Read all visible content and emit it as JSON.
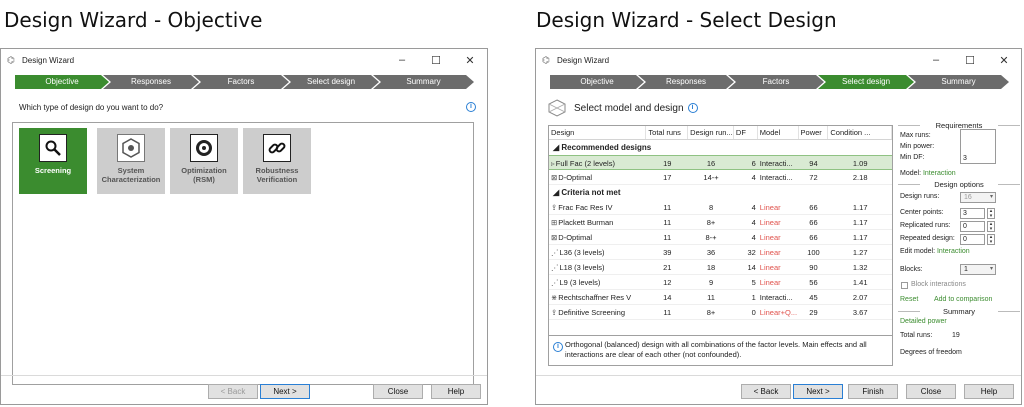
{
  "left": {
    "slide_title": "Design Wizard - Objective",
    "window_title": "Design Wizard",
    "steps": [
      "Objective",
      "Responses",
      "Factors",
      "Select design",
      "Summary"
    ],
    "question": "Which type of design do you want to do?",
    "tiles": [
      {
        "line1": "Screening",
        "line2": ""
      },
      {
        "line1": "System",
        "line2": "Characterization"
      },
      {
        "line1": "Optimization",
        "line2": "(RSM)"
      },
      {
        "line1": "Robustness",
        "line2": "Verification"
      }
    ],
    "buttons": {
      "back": "< Back",
      "next": "Next >",
      "close": "Close",
      "help": "Help"
    }
  },
  "right": {
    "slide_title": "Design Wizard - Select Design",
    "window_title": "Design Wizard",
    "steps": [
      "Objective",
      "Responses",
      "Factors",
      "Select design",
      "Summary"
    ],
    "header": "Select model and design",
    "columns": [
      "Design",
      "Total runs",
      "Design run...",
      "DF",
      "Model",
      "Power",
      "Condition ..."
    ],
    "recommended_label": "Recommended designs",
    "recommended": [
      {
        "icon": "▹",
        "design": "Full Fac (2 levels)",
        "total": "19",
        "runs": "16",
        "df": "6",
        "model": "Interacti...",
        "power": "94",
        "cond": "1.09"
      },
      {
        "icon": "⊠",
        "design": "D-Optimal",
        "total": "17",
        "runs": "14-+",
        "df": "4",
        "model": "Interacti...",
        "power": "72",
        "cond": "2.18"
      }
    ],
    "criteria_label": "Criteria not met",
    "criteria": [
      {
        "icon": "⇪",
        "design": "Frac Fac Res IV",
        "total": "11",
        "runs": "8",
        "df": "4",
        "model": "Linear",
        "power": "66",
        "cond": "1.17"
      },
      {
        "icon": "⊞",
        "design": "Plackett Burman",
        "total": "11",
        "runs": "8+",
        "df": "4",
        "model": "Linear",
        "power": "66",
        "cond": "1.17"
      },
      {
        "icon": "⊠",
        "design": "D-Optimal",
        "total": "11",
        "runs": "8-+",
        "df": "4",
        "model": "Linear",
        "power": "66",
        "cond": "1.17"
      },
      {
        "icon": "⋰",
        "design": "L36 (3 levels)",
        "total": "39",
        "runs": "36",
        "df": "32",
        "model": "Linear",
        "power": "100",
        "cond": "1.27"
      },
      {
        "icon": "⋰",
        "design": "L18 (3 levels)",
        "total": "21",
        "runs": "18",
        "df": "14",
        "model": "Linear",
        "power": "90",
        "cond": "1.32"
      },
      {
        "icon": "⋰",
        "design": "L9 (3 levels)",
        "total": "12",
        "runs": "9",
        "df": "5",
        "model": "Linear",
        "power": "56",
        "cond": "1.41"
      },
      {
        "icon": "⋇",
        "design": "Rechtschaffner Res V",
        "total": "14",
        "runs": "11",
        "df": "1",
        "model": "Interacti...",
        "power": "45",
        "cond": "2.07"
      },
      {
        "icon": "⇪",
        "design": "Definitive Screening",
        "total": "11",
        "runs": "8+",
        "df": "0",
        "model": "Linear+Q...",
        "power": "29",
        "cond": "3.67"
      }
    ],
    "note": "Orthogonal (balanced) design with all combinations of the factor levels. Main effects and all interactions are clear of each other (not confounded).",
    "side": {
      "requirements": "Requirements",
      "max_runs": "Max runs:",
      "min_power": "Min power:",
      "min_df": "Min DF:",
      "min_df_value": "3",
      "model_label": "Model:",
      "model_value": "Interaction",
      "design_options": "Design options",
      "design_runs": "Design runs:",
      "design_runs_value": "16",
      "center_points": "Center points:",
      "center_points_value": "3",
      "replicated_runs": "Replicated runs:",
      "replicated_runs_value": "0",
      "repeated_design": "Repeated design:",
      "repeated_design_value": "0",
      "edit_model": "Edit model:",
      "edit_model_value": "Interaction",
      "blocks": "Blocks:",
      "blocks_value": "1",
      "block_interactions": "Block interactions",
      "reset": "Reset",
      "add_to_comparison": "Add to comparison",
      "summary": "Summary",
      "detailed_power": "Detailed power",
      "total_runs_label": "Total runs:",
      "total_runs_value": "19",
      "degrees_of_freedom": "Degrees of freedom"
    },
    "buttons": {
      "back": "< Back",
      "next": "Next >",
      "finish": "Finish",
      "close": "Close",
      "help": "Help"
    }
  },
  "colors": {
    "active_step": "#3b8c2f",
    "inactive_step": "#6c6c6c",
    "accent_blue": "#2a7fd4",
    "linear_red": "#e0534d"
  }
}
